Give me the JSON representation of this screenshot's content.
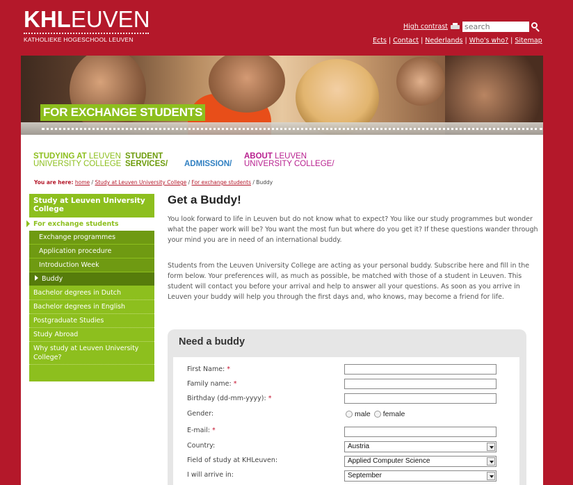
{
  "header": {
    "logo_bold": "KHL",
    "logo_light": "EUVEN",
    "logo_sub": "KATHOLIEKE HOGESCHOOL LEUVEN",
    "high_contrast": "High contrast",
    "search_placeholder": "search",
    "links": [
      "Ects",
      "Contact",
      "Nederlands",
      "Who's who?",
      "Sitemap"
    ]
  },
  "hero": {
    "label": "FOR EXCHANGE STUDENTS"
  },
  "nav": {
    "studying_bold": "STUDYING AT",
    "studying_rest_1": " LEUVEN",
    "studying_rest_2": "UNIVERSITY COLLEGE",
    "student_1": "STUDENT",
    "student_2": "SERVICES/",
    "admission": "ADMISSION/",
    "about_bold": "ABOUT",
    "about_rest_1": " LEUVEN",
    "about_rest_2": "UNIVERSITY COLLEGE/"
  },
  "breadcrumb": {
    "label": "You are here:",
    "items": [
      "home",
      "Study at Leuven University College",
      "For exchange students"
    ],
    "current": "Buddy"
  },
  "sidebar": {
    "title": "Study at Leuven University College",
    "active": "For exchange students",
    "sub": [
      "Exchange programmes",
      "Application procedure",
      "Introduction Week",
      "Buddy"
    ],
    "items": [
      "Bachelor degrees in Dutch",
      "Bachelor degrees in English",
      "Postgraduate Studies",
      "Study Abroad",
      "Why study at Leuven University College?"
    ]
  },
  "content": {
    "title": "Get a Buddy!",
    "para1": "You look forward to life in Leuven but do not know what to expect? You like our study programmes but wonder what the paper work will be? You want the most fun but where do you get it? If these questions wander through your mind you are in need of an international buddy.",
    "para2": "Students from the Leuven University College are acting as your personal buddy. Subscribe here and fill in the form below. Your preferences will, as much as possible, be matched with those of a student in Leuven. This student will contact you before your arrival and help to answer all your questions. As soon as you arrive in Leuven your buddy will help you through the first days and, who knows, may become a friend for life."
  },
  "form": {
    "title": "Need a buddy",
    "first_name": "First Name:",
    "family_name": "Family name:",
    "birthday": "Birthday (dd-mm-yyyy):",
    "gender": "Gender:",
    "male": "male",
    "female": "female",
    "email": "E-mail:",
    "country": "Country:",
    "country_value": "Austria",
    "field": "Field of study at KHLeuven:",
    "field_value": "Applied Computer Science",
    "arrive": "I will arrive in:",
    "arrive_value": "September",
    "required_mark": "*"
  }
}
